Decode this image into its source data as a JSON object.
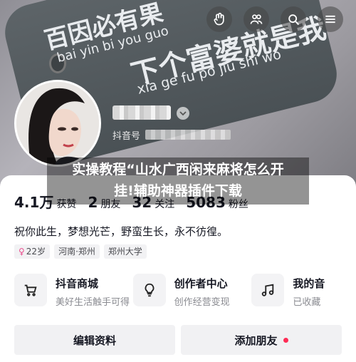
{
  "cover": {
    "tee_line1": "百因必有果",
    "tee_line2": "bai yin bi you guo",
    "tee_line3": "下个富婆就是我",
    "tee_line4": "xia ge fu po jiu shi wo"
  },
  "top_icons": [
    "hand-icon",
    "people-icon",
    "search-icon",
    "menu-icon"
  ],
  "profile": {
    "id_label": "抖音号"
  },
  "overlay": {
    "line1": "实操教程“山水广西闲来麻将怎么开",
    "line2": "挂!辅助神器插件下载"
  },
  "stats": [
    {
      "value": "4.1万",
      "label": "获赞"
    },
    {
      "value": "2",
      "label": "朋友"
    },
    {
      "value": "32",
      "label": "关注"
    },
    {
      "value": "5083",
      "label": "粉丝"
    }
  ],
  "bio": "祝你此生，梦想光芒，野蛮生长，永不彷徨。",
  "tags": [
    {
      "icon": "female-icon",
      "text": "22岁"
    },
    {
      "text": "河南·郑州"
    },
    {
      "text": "郑州大学"
    }
  ],
  "features": [
    {
      "icon": "cart-icon",
      "title": "抖音商城",
      "subtitle": "美好生活触手可得"
    },
    {
      "icon": "lightbulb-icon",
      "title": "创作者中心",
      "subtitle": "创作经营变现"
    },
    {
      "icon": "music-icon",
      "title": "我的音",
      "subtitle": "已收藏"
    }
  ],
  "buttons": {
    "edit": "编辑资料",
    "add_friend": "添加朋友"
  },
  "colors": {
    "accent_red": "#fe2c55",
    "gender_pink": "#e94e8d"
  }
}
